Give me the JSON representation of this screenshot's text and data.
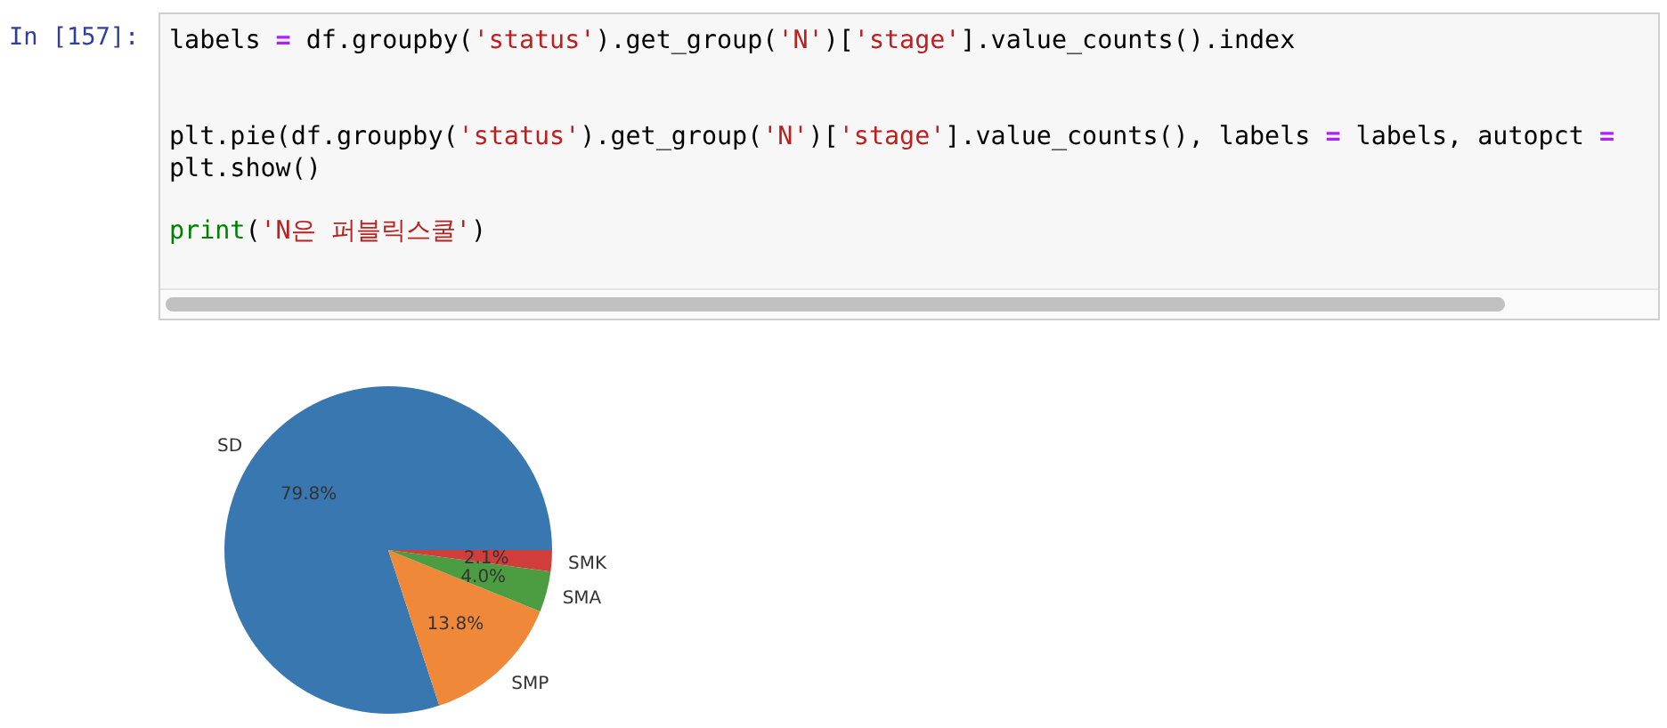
{
  "cell": {
    "prompt": "In [157]:",
    "code_blocks": [
      [
        [
          {
            "kind": "plain",
            "text": "labels "
          },
          {
            "kind": "operator",
            "text": "="
          },
          {
            "kind": "plain",
            "text": " df.groupby("
          },
          {
            "kind": "string",
            "text": "'status'"
          },
          {
            "kind": "plain",
            "text": ").get_group("
          },
          {
            "kind": "string",
            "text": "'N'"
          },
          {
            "kind": "plain",
            "text": ")["
          },
          {
            "kind": "string",
            "text": "'stage'"
          },
          {
            "kind": "plain",
            "text": "].value_counts().index"
          }
        ]
      ],
      [
        [
          {
            "kind": "plain",
            "text": "plt.pie(df.groupby("
          },
          {
            "kind": "string",
            "text": "'status'"
          },
          {
            "kind": "plain",
            "text": ").get_group("
          },
          {
            "kind": "string",
            "text": "'N'"
          },
          {
            "kind": "plain",
            "text": ")["
          },
          {
            "kind": "string",
            "text": "'stage'"
          },
          {
            "kind": "plain",
            "text": "].value_counts(), labels "
          },
          {
            "kind": "operator",
            "text": "="
          },
          {
            "kind": "plain",
            "text": " labels, autopct "
          },
          {
            "kind": "operator",
            "text": "="
          }
        ],
        [
          {
            "kind": "plain",
            "text": "plt.show()"
          }
        ]
      ],
      [
        [
          {
            "kind": "builtin",
            "text": "print"
          },
          {
            "kind": "plain",
            "text": "("
          },
          {
            "kind": "string",
            "text": "'N은 퍼블릭스쿨'"
          },
          {
            "kind": "plain",
            "text": ")"
          }
        ]
      ]
    ]
  },
  "output": {
    "chart_data": {
      "type": "pie",
      "categories": [
        "SD",
        "SMP",
        "SMA",
        "SMK"
      ],
      "values": [
        79.8,
        13.8,
        4.0,
        2.1
      ],
      "value_labels": [
        "79.8%",
        "13.8%",
        "4.0%",
        "2.1%"
      ]
    }
  }
}
